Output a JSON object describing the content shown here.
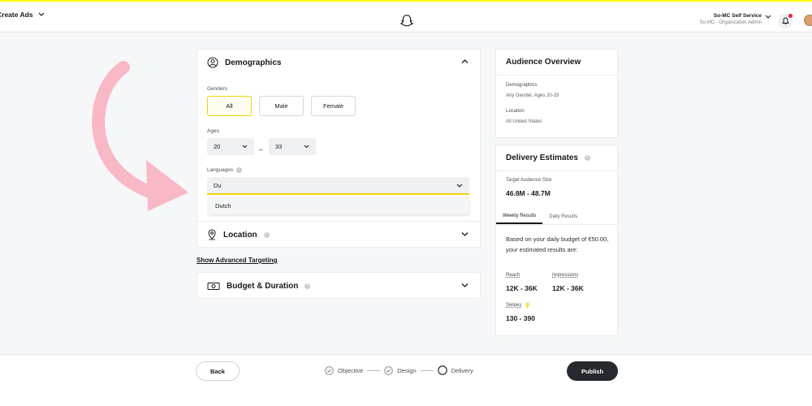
{
  "header": {
    "create_ads": "Create Ads",
    "org_name": "So-MC Self Service",
    "org_role": "So-MC - Organization Admin"
  },
  "demographics": {
    "title": "Demographics",
    "genders_label": "Genders",
    "genders": [
      "All",
      "Male",
      "Female"
    ],
    "selected_gender": "All",
    "ages_label": "Ages",
    "age_min": "20",
    "age_max": "33",
    "age_separator": "–",
    "languages_label": "Languages",
    "language_query": "Du",
    "language_suggestion": "Dutch"
  },
  "location": {
    "title": "Location"
  },
  "advanced_link": "Show Advanced Targeting",
  "budget": {
    "title": "Budget & Duration"
  },
  "audience_overview": {
    "title": "Audience Overview",
    "demographics_label": "Demographics",
    "demographics_value": "Any Gender, Ages 20-33",
    "location_label": "Location",
    "location_value": "All United States"
  },
  "delivery": {
    "title": "Delivery Estimates",
    "target_size_label": "Target Audience Size",
    "target_size_value": "46.8M - 48.7M",
    "tabs": [
      "Weekly Results",
      "Daily Results"
    ],
    "active_tab": "Weekly Results",
    "description": "Based on your daily budget of €50.00, your estimated results are:",
    "reach_label": "Reach",
    "reach_value": "12K - 36K",
    "impressions_label": "Impressions",
    "impressions_value": "12K - 36K",
    "swipes_label": "Swipes",
    "swipes_value": "130 - 390"
  },
  "footer": {
    "back": "Back",
    "steps": [
      "Objective",
      "Design",
      "Delivery"
    ],
    "publish": "Publish"
  },
  "colors": {
    "accent_yellow": "#fffc00",
    "selected_border": "#f2d300",
    "arrow_pink": "#f9b8c6",
    "publish_bg": "#262a2e"
  }
}
